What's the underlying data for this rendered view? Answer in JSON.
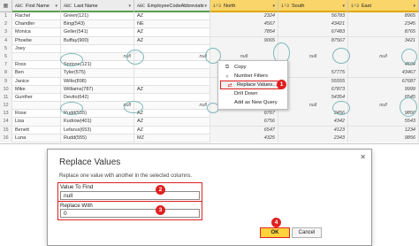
{
  "grid": {
    "columns": [
      {
        "type_icon": "ABC",
        "title": "First Name"
      },
      {
        "type_icon": "ABC",
        "title": "Last Name"
      },
      {
        "type_icon": "ABC",
        "title": "EmployeeCodeAbbreviation"
      },
      {
        "type_icon": "1²3",
        "title": "North"
      },
      {
        "type_icon": "1²3",
        "title": "South"
      },
      {
        "type_icon": "1²3",
        "title": "East"
      }
    ],
    "rows": [
      {
        "idx": "1",
        "first": "Rachel",
        "last": "Green(121)",
        "code": "AZ",
        "north": "2324",
        "south": "56783",
        "east": "8965"
      },
      {
        "idx": "2",
        "first": "Chandler",
        "last": "Bing(543)",
        "code": "NE",
        "north": "4567",
        "south": "43421",
        "east": "2345"
      },
      {
        "idx": "3",
        "first": "Monica",
        "last": "Geller(541)",
        "code": "AZ",
        "north": "7854",
        "south": "67483",
        "east": "8765"
      },
      {
        "idx": "4",
        "first": "Phoebe",
        "last": "Buffay(900)",
        "code": "AZ",
        "north": "9065",
        "south": "87567",
        "east": "3421"
      },
      {
        "idx": "5",
        "first": "Joey",
        "last": "",
        "code": "",
        "north": "",
        "south": "",
        "east": ""
      },
      {
        "idx": "6",
        "first": "",
        "last": "null",
        "code": "null",
        "north": "null",
        "south": "null",
        "east": "null"
      },
      {
        "idx": "7",
        "first": "Ross",
        "last": "Spriose(121)",
        "code": "",
        "north": "",
        "south": "",
        "east": "4564"
      },
      {
        "idx": "8",
        "first": "Ben",
        "last": "Tyler(575)",
        "code": "",
        "north": "",
        "south": "57775",
        "east": "43467"
      },
      {
        "idx": "9",
        "first": "Janice",
        "last": "Willis(898)",
        "code": "",
        "north": "",
        "south": "55555",
        "east": "67687"
      },
      {
        "idx": "10",
        "first": "Mike",
        "last": "Williams(787)",
        "code": "AZ",
        "north": "",
        "south": "67873",
        "east": "9999"
      },
      {
        "idx": "11",
        "first": "Gunther",
        "last": "Devito(642)",
        "code": "",
        "north": "",
        "south": "54354",
        "east": "6545"
      },
      {
        "idx": "12",
        "first": "",
        "last": "null",
        "code": "null",
        "north": "null",
        "south": "null",
        "east": "null"
      },
      {
        "idx": "13",
        "first": "Rose",
        "last": "Rudd(555)",
        "code": "AZ",
        "north": "6767",
        "south": "3456",
        "east": "9856"
      },
      {
        "idx": "14",
        "first": "Lisa",
        "last": "Kudrow(401)",
        "code": "AZ",
        "north": "6756",
        "south": "4342",
        "east": "5543"
      },
      {
        "idx": "15",
        "first": "Benett",
        "last": "Lefarus(653)",
        "code": "AZ",
        "north": "6547",
        "south": "4123",
        "east": "1234"
      },
      {
        "idx": "16",
        "first": "Luna",
        "last": "Rudd(555)",
        "code": "MZ",
        "north": "4325",
        "south": "2343",
        "east": "9856"
      }
    ]
  },
  "context_menu": {
    "items": [
      {
        "icon": "copy-icon",
        "label": "Copy"
      },
      {
        "icon": "number-filters-icon",
        "label": "Number Filters"
      },
      {
        "icon": "replace-values-icon",
        "label": "Replace Values..."
      },
      {
        "icon": "",
        "label": "Drill Down"
      },
      {
        "icon": "",
        "label": "Add as New Query"
      }
    ]
  },
  "badges": {
    "b1": "1",
    "b2": "2",
    "b3": "3",
    "b4": "4"
  },
  "dialog": {
    "title": "Replace Values",
    "close": "✕",
    "description": "Replace one value with another in the selected columns.",
    "value_to_find_label": "Value To Find",
    "value_to_find_value": "null",
    "replace_with_label": "Replace With",
    "replace_with_value": "0",
    "ok_label": "OK",
    "cancel_label": "Cancel"
  },
  "colors": {
    "accent": "#e02020",
    "ok_fill": "#ffd23c",
    "header_highlight": "#f9d56a",
    "ring": "#7fb8b8"
  }
}
